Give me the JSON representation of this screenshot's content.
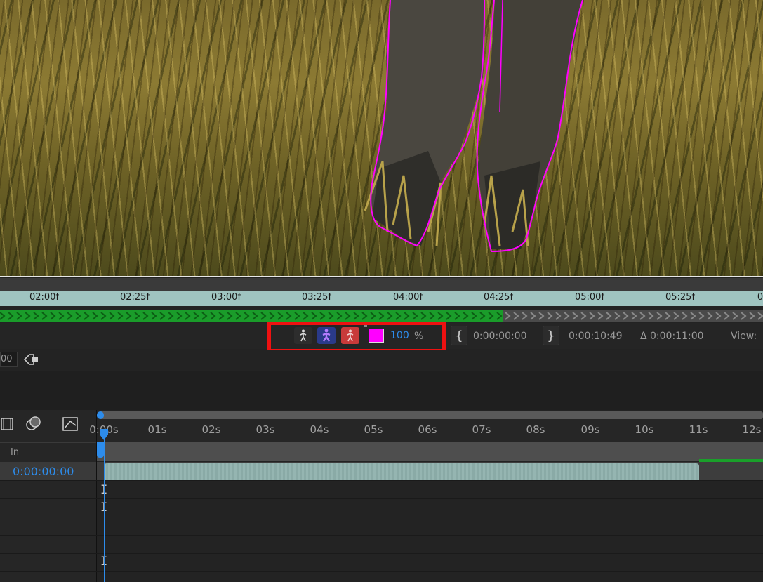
{
  "colors": {
    "accent": "#2d8ceb",
    "mask_outline": "#ff00ff",
    "highlight": "#ee1111",
    "track_green": "#1a9c2a"
  },
  "layer_panel": {
    "ruler_ticks": [
      "02:00f",
      "02:25f",
      "03:00f",
      "03:25f",
      "04:00f",
      "04:25f",
      "05:00f",
      "05:25f",
      "0"
    ],
    "tracked_progress": 0.66,
    "toolbar": {
      "walk_icon": "person-walk-icon",
      "refine_icon": "refine-edge-icon",
      "foreground_icon": "foreground-person-icon",
      "opacity_value": "100",
      "opacity_unit": "%"
    },
    "in_point": "0:00:00:00",
    "out_point": "0:00:10:49",
    "duration": "Δ 0:00:11:00",
    "view_label": "View:",
    "zoom_value": "00"
  },
  "timeline": {
    "ruler_ticks": [
      "0:00s",
      "01s",
      "02s",
      "03s",
      "04s",
      "05s",
      "06s",
      "07s",
      "08s",
      "09s",
      "10s",
      "11s",
      "12s"
    ],
    "columns": {
      "in_label": "In"
    },
    "layer": {
      "in_time": "0:00:00:00"
    },
    "ibeam": "I"
  }
}
